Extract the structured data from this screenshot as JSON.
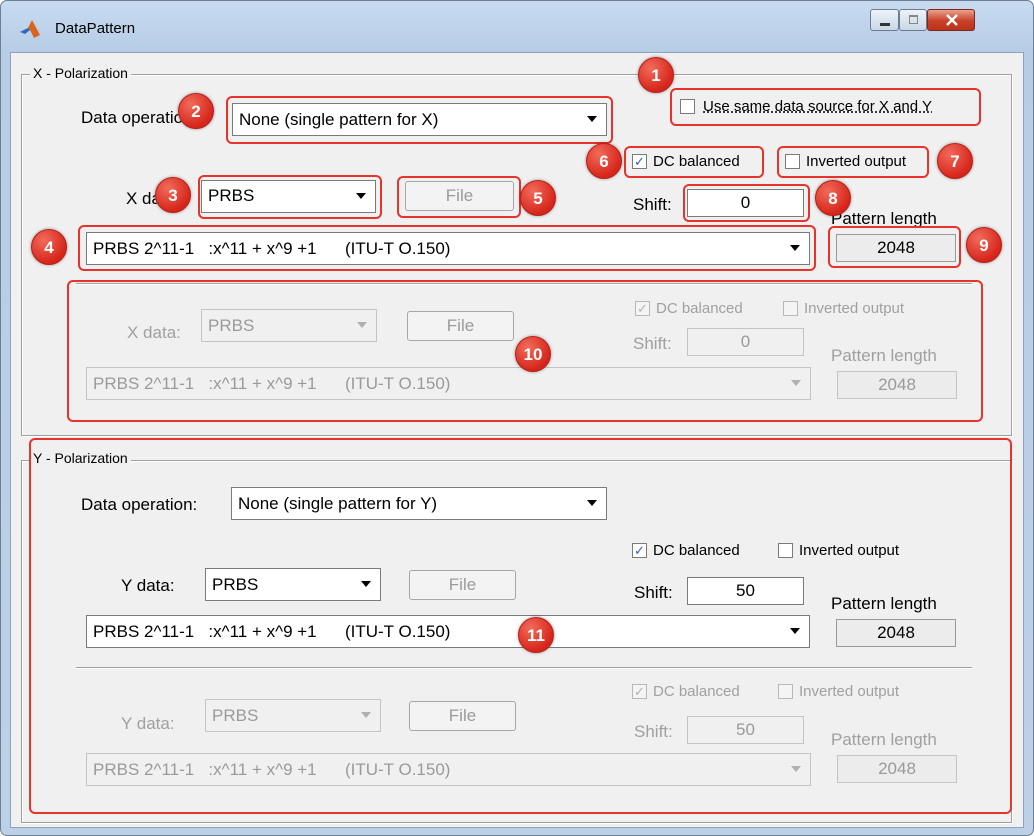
{
  "window": {
    "title": "DataPattern"
  },
  "x_panel": {
    "legend": "X - Polarization",
    "data_operation_label": "Data operation:",
    "data_operation_value": "None (single pattern for X)",
    "same_source_label": "Use same data source for X and Y",
    "same_source_checked": false,
    "primary": {
      "data_label": "X data:",
      "data_type": "PRBS",
      "file_label": "File",
      "dc_balanced_label": "DC balanced",
      "dc_balanced_checked": true,
      "inverted_label": "Inverted output",
      "inverted_checked": false,
      "shift_label": "Shift:",
      "shift_value": "0",
      "pattern_label": "Pattern length",
      "pattern_value": "2048",
      "poly": "PRBS 2^11-1   :x^11 + x^9 +1      (ITU-T O.150)"
    },
    "secondary": {
      "data_label": "X data:",
      "data_type": "PRBS",
      "file_label": "File",
      "dc_balanced_label": "DC balanced",
      "dc_balanced_checked": true,
      "inverted_label": "Inverted output",
      "inverted_checked": false,
      "shift_label": "Shift:",
      "shift_value": "0",
      "pattern_label": "Pattern length",
      "pattern_value": "2048",
      "poly": "PRBS 2^11-1   :x^11 + x^9 +1      (ITU-T O.150)"
    }
  },
  "y_panel": {
    "legend": "Y -  Polarization",
    "data_operation_label": "Data operation:",
    "data_operation_value": "None (single pattern for Y)",
    "primary": {
      "data_label": "Y data:",
      "data_type": "PRBS",
      "file_label": "File",
      "dc_balanced_label": "DC balanced",
      "dc_balanced_checked": true,
      "inverted_label": "Inverted output",
      "inverted_checked": false,
      "shift_label": "Shift:",
      "shift_value": "50",
      "pattern_label": "Pattern length",
      "pattern_value": "2048",
      "poly": "PRBS 2^11-1   :x^11 + x^9 +1      (ITU-T O.150)"
    },
    "secondary": {
      "data_label": "Y data:",
      "data_type": "PRBS",
      "file_label": "File",
      "dc_balanced_label": "DC balanced",
      "dc_balanced_checked": true,
      "inverted_label": "Inverted output",
      "inverted_checked": false,
      "shift_label": "Shift:",
      "shift_value": "50",
      "pattern_label": "Pattern length",
      "pattern_value": "2048",
      "poly": "PRBS 2^11-1   :x^11 + x^9 +1      (ITU-T O.150)"
    }
  },
  "markers": [
    "1",
    "2",
    "3",
    "4",
    "5",
    "6",
    "7",
    "8",
    "9",
    "10",
    "11"
  ],
  "colors": {
    "highlight": "#e8332a",
    "marker": "#d6261b",
    "check": "#2d5fc4"
  },
  "icons": {
    "app": "matlab-logo-icon",
    "check": "✓"
  }
}
